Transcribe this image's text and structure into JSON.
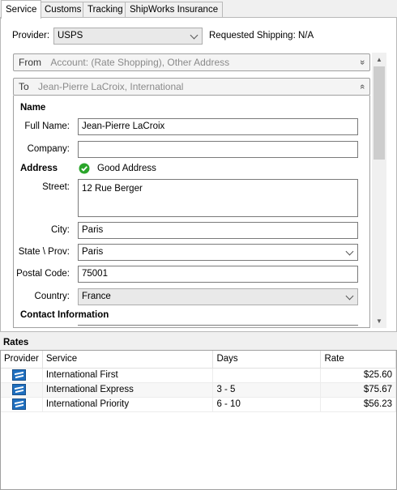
{
  "tabs": [
    {
      "label": "Service"
    },
    {
      "label": "Customs"
    },
    {
      "label": "Tracking"
    },
    {
      "label": "ShipWorks Insurance"
    }
  ],
  "provider": {
    "label": "Provider:",
    "value": "USPS",
    "requested_shipping": "Requested Shipping: N/A"
  },
  "from_section": {
    "title": "From",
    "summary": "Account: (Rate Shopping), Other Address",
    "toggle": "»"
  },
  "to_section": {
    "title": "To",
    "summary": "Jean-Pierre LaCroix, International",
    "toggle": "«"
  },
  "name_group": {
    "heading": "Name",
    "full_name_label": "Full Name:",
    "full_name": "Jean-Pierre LaCroix",
    "company_label": "Company:",
    "company": ""
  },
  "address_group": {
    "heading": "Address",
    "validation": "Good Address",
    "street_label": "Street:",
    "street": "12 Rue Berger",
    "city_label": "City:",
    "city": "Paris",
    "state_label": "State \\ Prov:",
    "state": "Paris",
    "postal_label": "Postal Code:",
    "postal": "75001",
    "country_label": "Country:",
    "country": "France"
  },
  "contact_group": {
    "heading": "Contact Information"
  },
  "rates": {
    "title": "Rates",
    "columns": [
      "Provider",
      "Service",
      "Days",
      "Rate"
    ],
    "rows": [
      {
        "provider_icon": "usps-icon",
        "service": "International First",
        "days": "",
        "rate": "$25.60"
      },
      {
        "provider_icon": "usps-icon",
        "service": "International Express",
        "days": "3 - 5",
        "rate": "$75.67"
      },
      {
        "provider_icon": "usps-icon",
        "service": "International Priority",
        "days": "6 - 10",
        "rate": "$56.23"
      }
    ]
  },
  "colors": {
    "accent": "#1f6fbf",
    "check": "#2aa52a"
  }
}
